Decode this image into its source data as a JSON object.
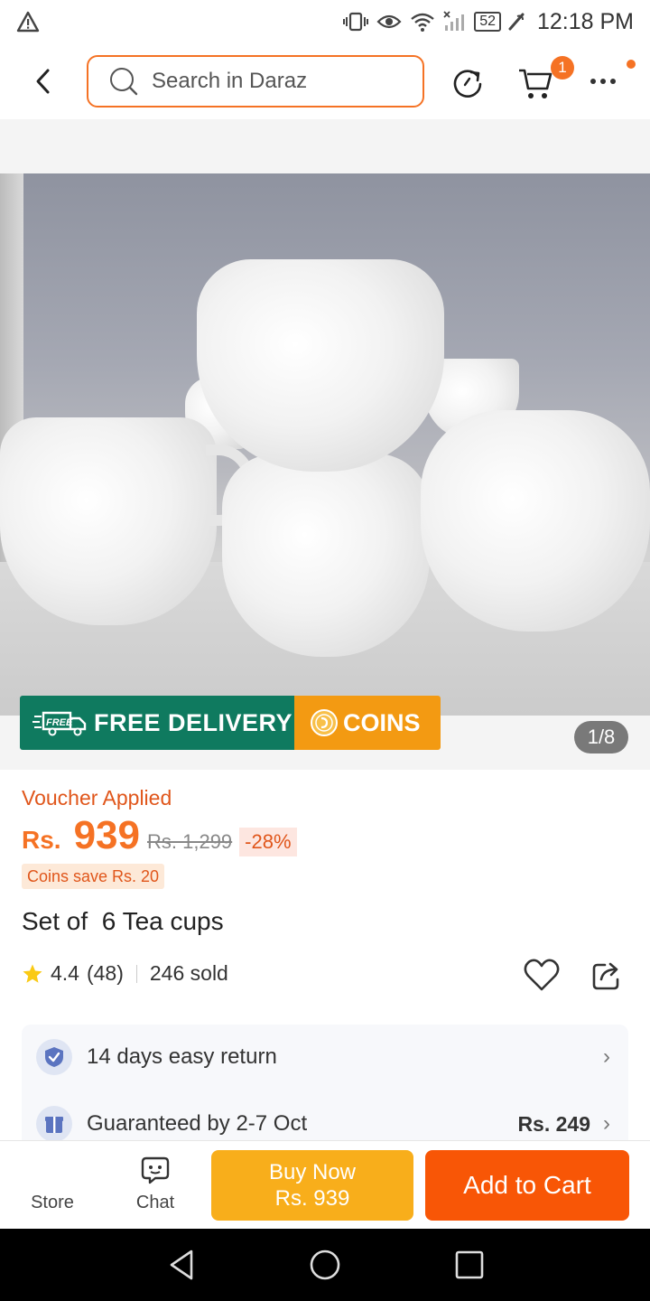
{
  "status_bar": {
    "time": "12:18 PM",
    "battery": "52",
    "icons": [
      "warning-icon",
      "vibrate-icon",
      "eye-icon",
      "wifi-icon",
      "signal-icon",
      "battery-icon",
      "battery-saver-icon"
    ]
  },
  "header": {
    "search_placeholder": "Search in Daraz",
    "cart_count": "1",
    "icons": [
      "back-arrow-icon",
      "search-icon",
      "refresh-icon",
      "cart-icon",
      "more-icon"
    ]
  },
  "product": {
    "image_counter": "1/8",
    "promo": {
      "free_delivery": "FREE DELIVERY",
      "free_tag": "FREE",
      "coins": "COINS"
    },
    "voucher_label": "Voucher Applied",
    "currency": "Rs.",
    "price": "939",
    "original_price": "Rs. 1,299",
    "discount": "-28%",
    "coins_save": "Coins save Rs. 20",
    "title": "Set of  6 Tea cups",
    "rating": "4.4",
    "rating_count": "(48)",
    "sold": "246 sold"
  },
  "services": [
    {
      "icon": "shield-check-icon",
      "text": "14 days easy return",
      "value": ""
    },
    {
      "icon": "delivery-box-icon",
      "text": "Guaranteed by 2-7 Oct",
      "value": "Rs. 249"
    }
  ],
  "bottom_bar": {
    "store_label": "Store",
    "chat_label": "Chat",
    "buy_now_label": "Buy Now",
    "buy_now_price": "Rs. 939",
    "add_to_cart_label": "Add to Cart"
  },
  "colors": {
    "brand": "#f57224",
    "buy_now": "#f8ae1b",
    "add_to_cart": "#f85606",
    "free_delivery": "#0f7a5f",
    "coins": "#f39a12"
  }
}
